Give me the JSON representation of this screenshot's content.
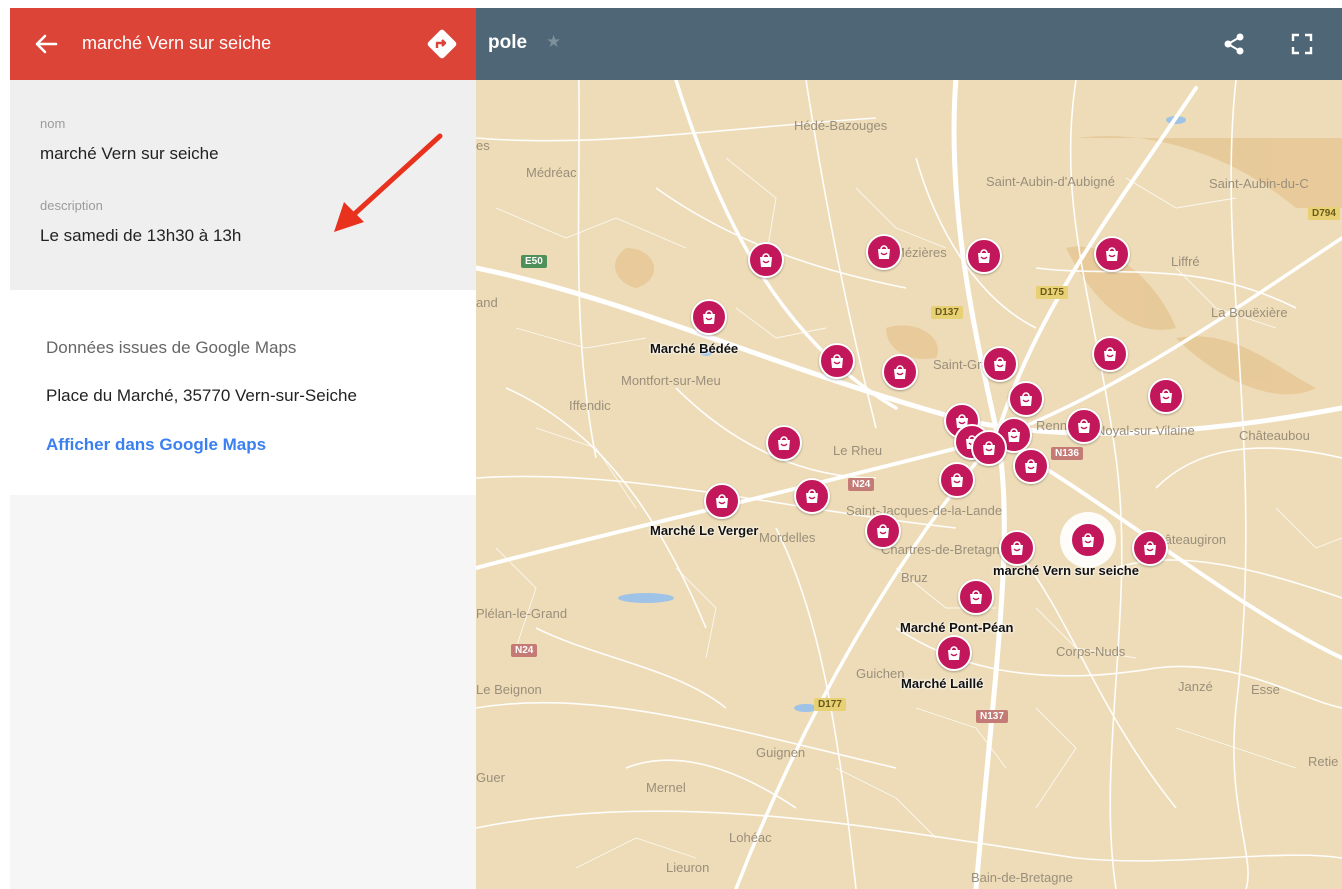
{
  "header": {
    "back_icon": "arrow-left-icon",
    "title": "marché Vern sur seiche",
    "directions_icon": "directions-icon"
  },
  "details": {
    "name_label": "nom",
    "name_value": "marché Vern sur seiche",
    "description_label": "description",
    "description_value": "Le samedi de 13h30 à 13h"
  },
  "google_maps": {
    "heading": "Données issues de Google Maps",
    "address": "Place du Marché, 35770 Vern-sur-Seiche",
    "link": "Afficher dans Google Maps"
  },
  "map_header": {
    "title": "pole",
    "star_icon": "star-icon",
    "share_icon": "share-icon",
    "fullscreen_icon": "fullscreen-icon"
  },
  "map": {
    "places": [
      "Hédé-Bazouges",
      "Médréac",
      "Saint-Aubin-d'Aubigné",
      "Saint-Aubin-du-C",
      "Mézières",
      "Liffré",
      "La Bouëxière",
      "Montfort-sur-Meu",
      "Iffendic",
      "Saint-Grégoire",
      "Le Rheu",
      "Noyal-sur-Vilaine",
      "Châteaubou",
      "Saint-Jacques-de-la-Lande",
      "Mordelles",
      "Chartres-de-Bretagne",
      "Bruz",
      "Châteaugiron",
      "Corps-Nuds",
      "Guichen",
      "Janzé",
      "Esse",
      "Plélan-le-Grand",
      "Le Beignon",
      "Guignen",
      "Guer",
      "Mernel",
      "Lohéac",
      "Lieuron",
      "Bain-de-Bretagne",
      "Retie",
      "Rennes",
      "es",
      "and"
    ],
    "roads": [
      "E50",
      "D137",
      "D175",
      "D794",
      "N24",
      "N136",
      "N24",
      "D177",
      "N137"
    ],
    "marker_labels": [
      "Marché Bédée",
      "Marché Le Verger",
      "marché Vern sur seiche",
      "Marché Pont-Péan",
      "Marché Laillé"
    ],
    "marker_icon": "shopping-bag-icon"
  },
  "colors": {
    "header_red": "#db4437",
    "map_header": "#4e6675",
    "marker": "#c2185b",
    "link": "#3b80f0",
    "arrow": "#e8321e"
  }
}
